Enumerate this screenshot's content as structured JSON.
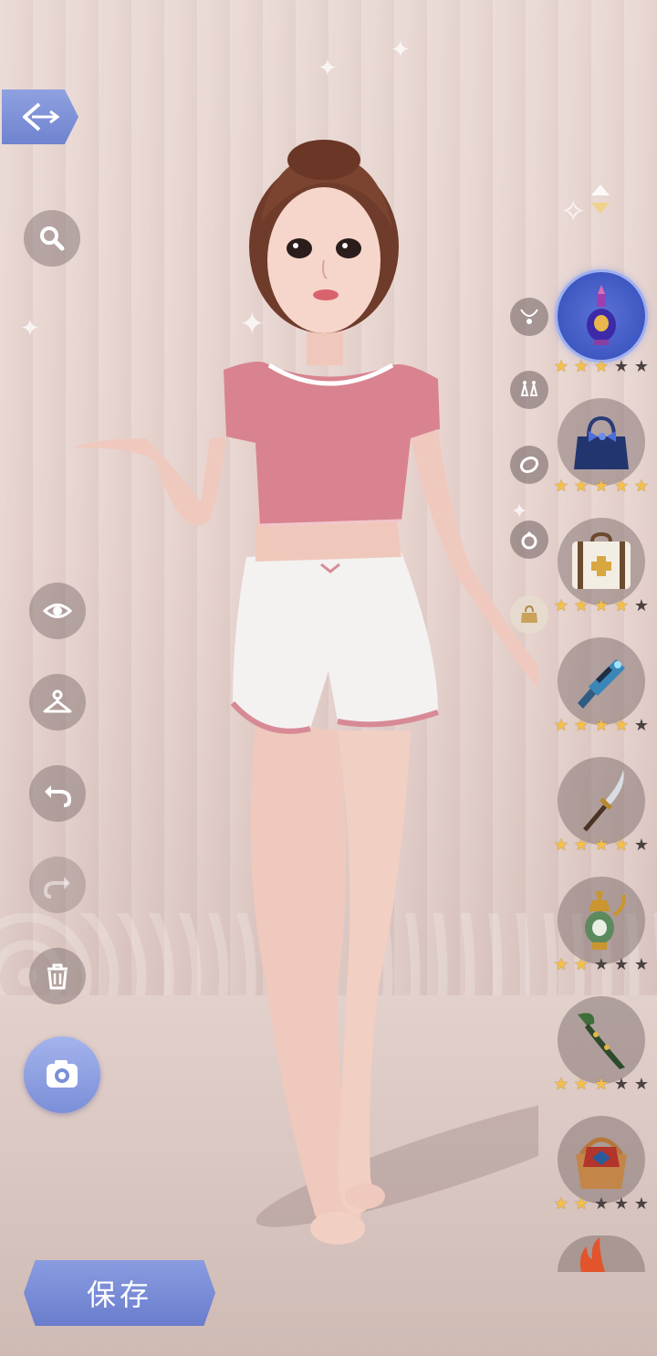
{
  "save_button": {
    "label": "保存"
  },
  "left_tools": [
    {
      "name": "search-icon"
    },
    {
      "name": "eye-icon"
    },
    {
      "name": "hanger-icon"
    },
    {
      "name": "undo-icon"
    },
    {
      "name": "redo-icon"
    },
    {
      "name": "trash-icon"
    }
  ],
  "categories": [
    {
      "name": "necklace-icon"
    },
    {
      "name": "earrings-icon"
    },
    {
      "name": "bracelet-icon"
    },
    {
      "name": "ring-icon"
    },
    {
      "name": "handbag-icon",
      "active": true
    }
  ],
  "items": [
    {
      "name": "perfume-bottle",
      "stars": 3,
      "max_stars": 5,
      "selected": true
    },
    {
      "name": "blue-handbag",
      "stars": 5,
      "max_stars": 5
    },
    {
      "name": "medical-suitcase",
      "stars": 4,
      "max_stars": 5
    },
    {
      "name": "blue-blaster",
      "stars": 4,
      "max_stars": 5
    },
    {
      "name": "long-sword",
      "stars": 4,
      "max_stars": 5
    },
    {
      "name": "ornate-ewer",
      "stars": 2,
      "max_stars": 5
    },
    {
      "name": "curved-dagger",
      "stars": 3,
      "max_stars": 5
    },
    {
      "name": "woven-basket",
      "stars": 2,
      "max_stars": 5
    }
  ],
  "colors": {
    "accent": "#7b8fd8",
    "star_on": "#f4c04a",
    "star_off": "#4a4242",
    "top": "#d8838f",
    "shorts": "#f4f1f1"
  }
}
